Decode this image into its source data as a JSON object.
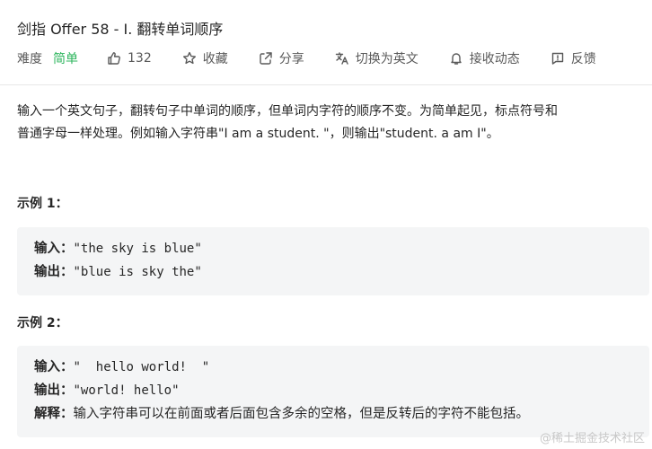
{
  "title": "剑指 Offer 58 - I. 翻转单词顺序",
  "toolbar": {
    "difficulty_label": "难度",
    "difficulty_value": "简单",
    "likes": "132",
    "favorite": "收藏",
    "share": "分享",
    "switch_lang": "切换为英文",
    "notify": "接收动态",
    "feedback": "反馈",
    "difficulty_color": "#2db55d"
  },
  "description": {
    "line1": "输入一个英文句子，翻转句子中单词的顺序，但单词内字符的顺序不变。为简单起见，标点符号和",
    "line2": "普通字母一样处理。例如输入字符串\"I am a student. \"，则输出\"student. a am I\"。"
  },
  "examples": [
    {
      "title": "示例 1：",
      "input_label": "输入：",
      "input_value": "\"the sky is blue\"",
      "output_label": "输出：",
      "output_value": "\"blue is sky the\""
    },
    {
      "title": "示例 2：",
      "input_label": "输入：",
      "input_value": "\"  hello world!  \"",
      "output_label": "输出：",
      "output_value": "\"world! hello\"",
      "explain_label": "解释：",
      "explain_value": "输入字符串可以在前面或者后面包含多余的空格，但是反转后的字符不能包括。"
    }
  ],
  "watermark": "@稀土掘金技术社区"
}
